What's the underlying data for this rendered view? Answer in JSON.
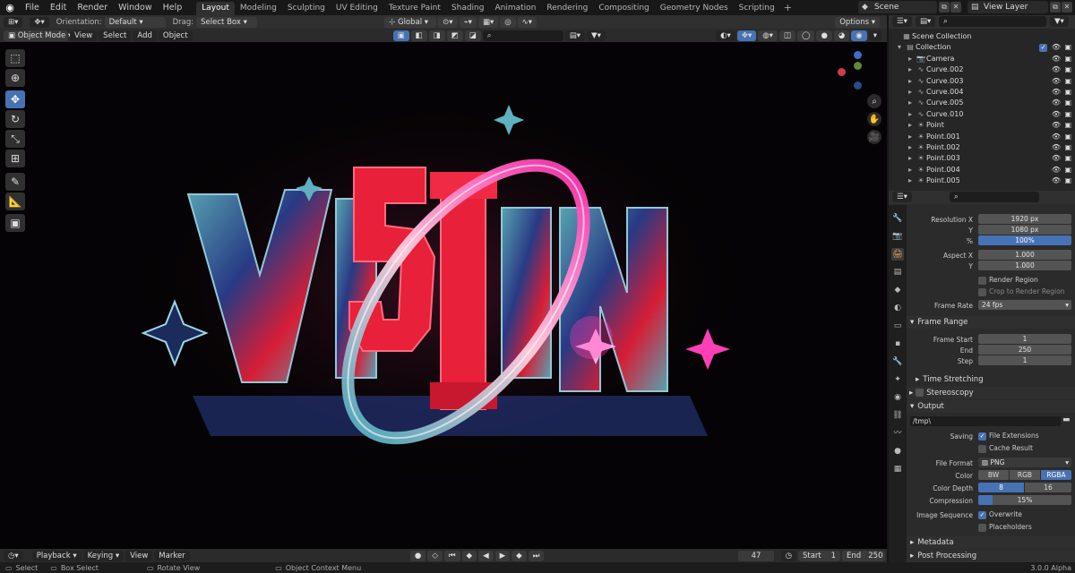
{
  "app": {
    "menus": [
      "File",
      "Edit",
      "Render",
      "Window",
      "Help"
    ],
    "workspaces": [
      "Layout",
      "Modeling",
      "Sculpting",
      "UV Editing",
      "Texture Paint",
      "Shading",
      "Animation",
      "Rendering",
      "Compositing",
      "Geometry Nodes",
      "Scripting"
    ],
    "active_workspace": "Layout",
    "plus": "+",
    "scene": "Scene",
    "view_layer": "View Layer"
  },
  "tool_header": {
    "orientation_label": "Orientation:",
    "orientation_value": "Default",
    "drag_label": "Drag:",
    "drag_value": "Select Box",
    "transform_orientation": "Global",
    "options": "Options"
  },
  "viewport_header": {
    "mode": "Object Mode",
    "menus": [
      "View",
      "Select",
      "Add",
      "Object"
    ]
  },
  "viewport": {
    "artwork_title": "Vi5ION",
    "artwork_colors": {
      "red": "#e8203a",
      "cyan": "#5fb0c0",
      "magenta": "#ff3fb5",
      "blue": "#3c5fd8"
    }
  },
  "outliner": {
    "root": "Scene Collection",
    "collection": "Collection",
    "items": [
      {
        "name": "Camera",
        "icon": "camera-icon"
      },
      {
        "name": "Curve.002",
        "icon": "curve-icon"
      },
      {
        "name": "Curve.003",
        "icon": "curve-icon"
      },
      {
        "name": "Curve.004",
        "icon": "curve-icon"
      },
      {
        "name": "Curve.005",
        "icon": "curve-icon"
      },
      {
        "name": "Curve.010",
        "icon": "curve-icon"
      },
      {
        "name": "Point",
        "icon": "light-icon"
      },
      {
        "name": "Point.001",
        "icon": "light-icon"
      },
      {
        "name": "Point.002",
        "icon": "light-icon"
      },
      {
        "name": "Point.003",
        "icon": "light-icon"
      },
      {
        "name": "Point.004",
        "icon": "light-icon"
      },
      {
        "name": "Point.005",
        "icon": "light-icon"
      }
    ]
  },
  "properties": {
    "resolution_x_label": "Resolution X",
    "resolution_x": "1920 px",
    "y_label": "Y",
    "resolution_y": "1080 px",
    "percent_label": "%",
    "percent": "100%",
    "aspect_x_label": "Aspect X",
    "aspect_x": "1.000",
    "aspect_y": "1.000",
    "render_region": "Render Region",
    "crop_region": "Crop to Render Region",
    "frame_rate_label": "Frame Rate",
    "frame_rate": "24 fps",
    "frame_range_header": "Frame Range",
    "frame_start_label": "Frame Start",
    "frame_start": "1",
    "end_label": "End",
    "frame_end": "250",
    "step_label": "Step",
    "frame_step": "1",
    "time_stretching": "Time Stretching",
    "stereoscopy": "Stereoscopy",
    "output_header": "Output",
    "output_path": "/tmp\\",
    "saving_label": "Saving",
    "file_extensions": "File Extensions",
    "cache_result": "Cache Result",
    "file_format_label": "File Format",
    "file_format": "PNG",
    "color_label": "Color",
    "color_options": [
      "BW",
      "RGB",
      "RGBA"
    ],
    "color_depth_label": "Color Depth",
    "depth_options": [
      "8",
      "16"
    ],
    "compression_label": "Compression",
    "compression": "15%",
    "compression_value": 15,
    "image_sequence_label": "Image Sequence",
    "overwrite": "Overwrite",
    "placeholders": "Placeholders",
    "metadata": "Metadata",
    "post_processing": "Post Processing"
  },
  "timeline": {
    "playback": "Playback",
    "keying": "Keying",
    "view": "View",
    "marker": "Marker",
    "current_frame": "47",
    "start_label": "Start",
    "start": "1",
    "end_label": "End",
    "end": "250"
  },
  "status_bar": {
    "select": "Select",
    "box_select": "Box Select",
    "rotate_view": "Rotate View",
    "context_menu": "Object Context Menu",
    "version": "3.0.0 Alpha"
  }
}
